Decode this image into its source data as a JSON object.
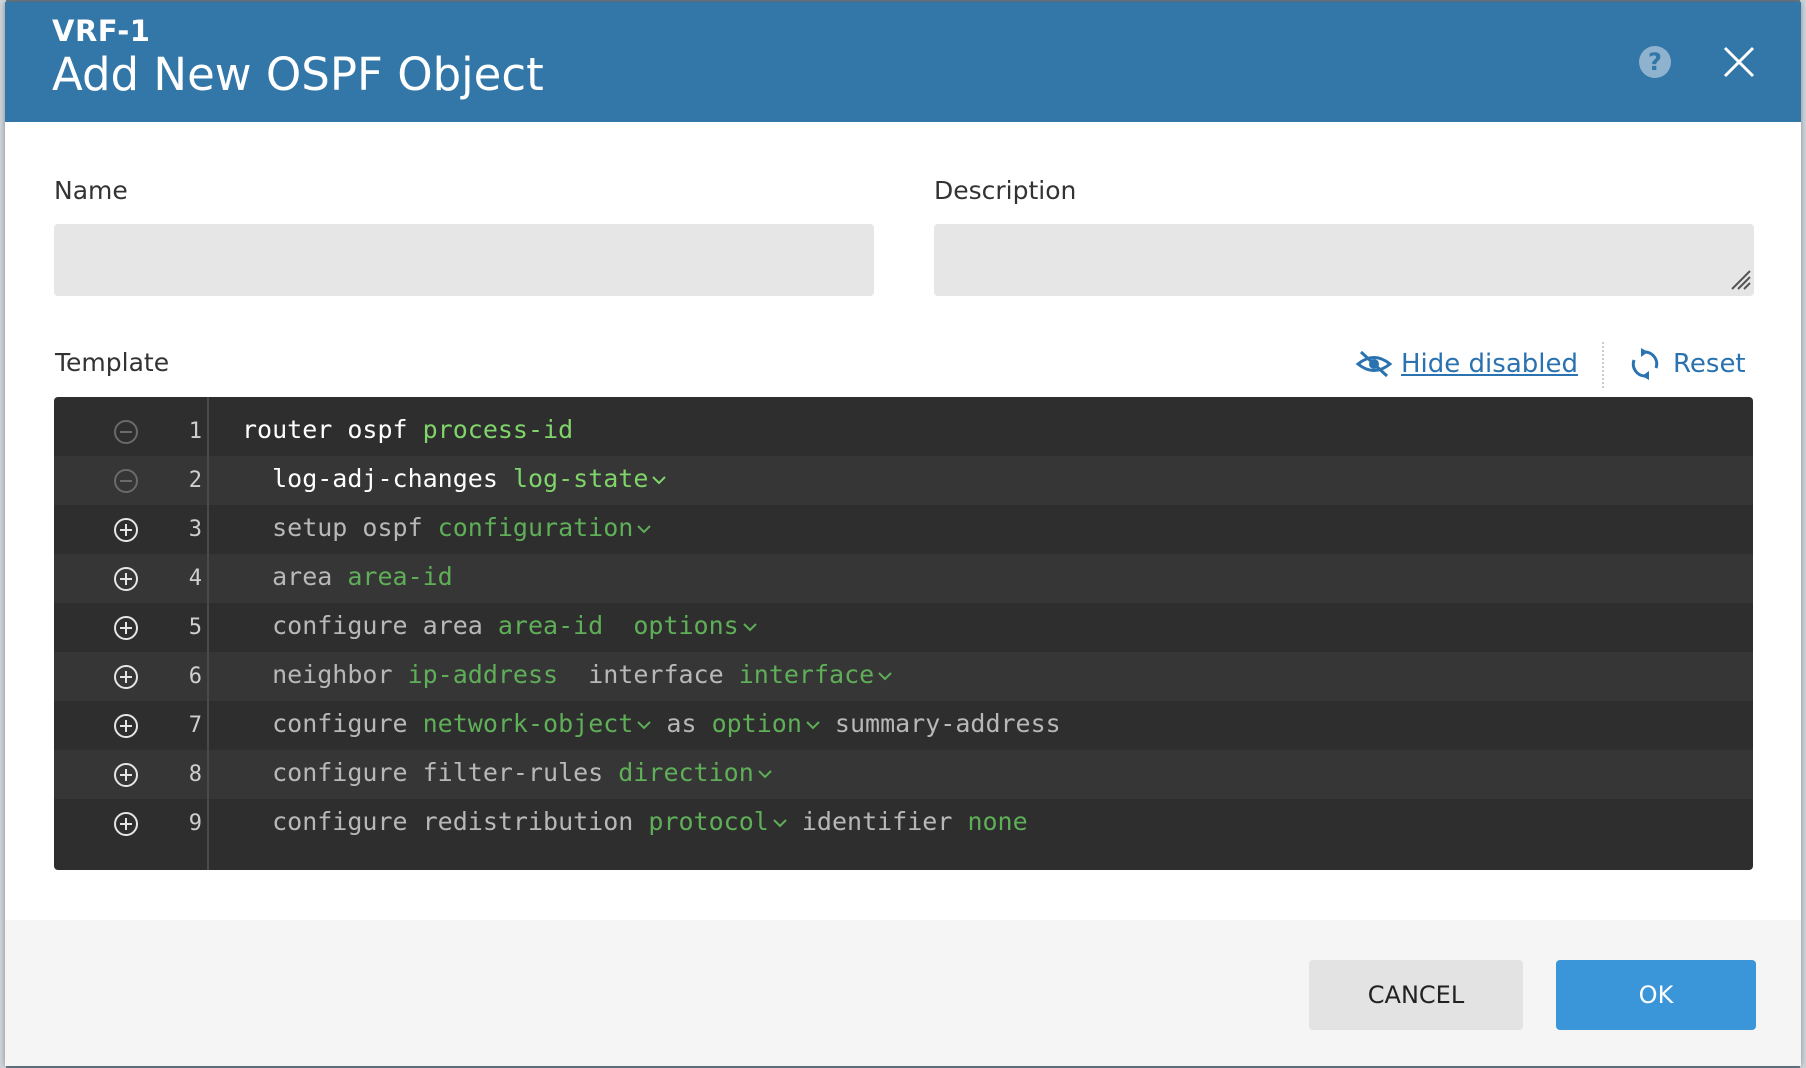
{
  "header": {
    "subtitle": "VRF-1",
    "title": "Add New OSPF Object",
    "help_icon": "question-circle-icon",
    "close_icon": "close-icon"
  },
  "form": {
    "name_label": "Name",
    "name_value": "",
    "description_label": "Description",
    "description_value": "",
    "template_label": "Template"
  },
  "template_actions": {
    "hide_disabled_label": "Hide disabled",
    "hide_disabled_icon": "eye-slash-icon",
    "reset_label": "Reset",
    "reset_icon": "refresh-icon"
  },
  "editor": {
    "lines": [
      {
        "no": "1",
        "toggle": "minus",
        "enabled": true,
        "tokens": [
          {
            "t": "router ospf ",
            "k": "kw"
          },
          {
            "t": "process-id",
            "k": "ph"
          }
        ]
      },
      {
        "no": "2",
        "toggle": "minus",
        "enabled": true,
        "tokens": [
          {
            "t": "  log-adj-changes ",
            "k": "kw"
          },
          {
            "t": "log-state",
            "k": "ph",
            "dropdown": true
          }
        ]
      },
      {
        "no": "3",
        "toggle": "plus",
        "enabled": false,
        "tokens": [
          {
            "t": "  setup ospf ",
            "k": "kw"
          },
          {
            "t": "configuration",
            "k": "ph",
            "dropdown": true
          }
        ]
      },
      {
        "no": "4",
        "toggle": "plus",
        "enabled": false,
        "tokens": [
          {
            "t": "  area ",
            "k": "kw"
          },
          {
            "t": "area-id",
            "k": "ph"
          }
        ]
      },
      {
        "no": "5",
        "toggle": "plus",
        "enabled": false,
        "tokens": [
          {
            "t": "  configure area ",
            "k": "kw"
          },
          {
            "t": "area-id",
            "k": "ph"
          },
          {
            "t": "  ",
            "k": "kw"
          },
          {
            "t": "options",
            "k": "ph",
            "dropdown": true
          }
        ]
      },
      {
        "no": "6",
        "toggle": "plus",
        "enabled": false,
        "tokens": [
          {
            "t": "  neighbor ",
            "k": "kw"
          },
          {
            "t": "ip-address",
            "k": "ph"
          },
          {
            "t": "  interface ",
            "k": "kw"
          },
          {
            "t": "interface",
            "k": "ph",
            "dropdown": true
          }
        ]
      },
      {
        "no": "7",
        "toggle": "plus",
        "enabled": false,
        "tokens": [
          {
            "t": "  configure ",
            "k": "kw"
          },
          {
            "t": "network-object",
            "k": "ph",
            "dropdown": true
          },
          {
            "t": " as ",
            "k": "kw"
          },
          {
            "t": "option",
            "k": "ph",
            "dropdown": true
          },
          {
            "t": " summary-address",
            "k": "kw"
          }
        ]
      },
      {
        "no": "8",
        "toggle": "plus",
        "enabled": false,
        "tokens": [
          {
            "t": "  configure filter-rules ",
            "k": "kw"
          },
          {
            "t": "direction",
            "k": "ph",
            "dropdown": true
          }
        ]
      },
      {
        "no": "9",
        "toggle": "plus",
        "enabled": false,
        "tokens": [
          {
            "t": "  configure redistribution ",
            "k": "kw"
          },
          {
            "t": "protocol",
            "k": "ph",
            "dropdown": true
          },
          {
            "t": " identifier ",
            "k": "kw"
          },
          {
            "t": "none",
            "k": "ph"
          }
        ]
      }
    ]
  },
  "footer": {
    "cancel_label": "CANCEL",
    "ok_label": "OK"
  },
  "colors": {
    "header_bg": "#3277a8",
    "editor_bg": "#2e2e2e",
    "placeholder_green": "#7fd46a",
    "link_blue": "#2a72b0",
    "ok_blue": "#3a96d8"
  }
}
